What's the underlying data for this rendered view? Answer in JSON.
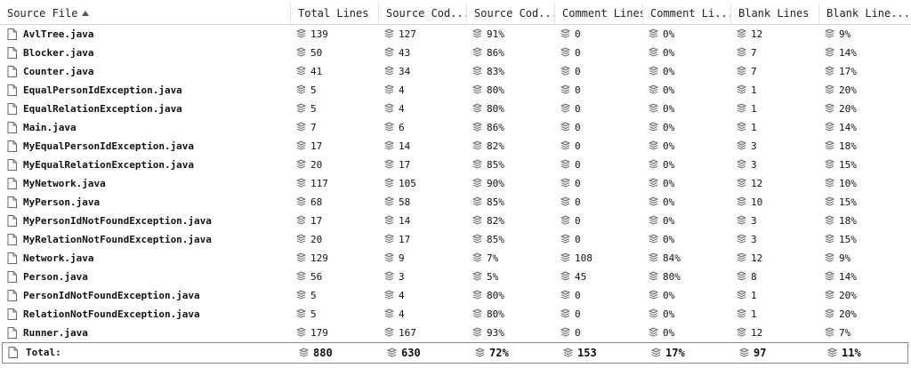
{
  "columns": [
    {
      "label": "Source File",
      "sorted": "ascending"
    },
    {
      "label": "Total Lines"
    },
    {
      "label": "Source Cod..."
    },
    {
      "label": "Source Cod..."
    },
    {
      "label": "Comment Lines"
    },
    {
      "label": "Comment Li..."
    },
    {
      "label": "Blank Lines"
    },
    {
      "label": "Blank Line..."
    }
  ],
  "rows": [
    {
      "file": "AvlTree.java",
      "total": "139",
      "src": "127",
      "src_pct": "91%",
      "cmt": "0",
      "cmt_pct": "0%",
      "blank": "12",
      "blank_pct": "9%"
    },
    {
      "file": "Blocker.java",
      "total": "50",
      "src": "43",
      "src_pct": "86%",
      "cmt": "0",
      "cmt_pct": "0%",
      "blank": "7",
      "blank_pct": "14%"
    },
    {
      "file": "Counter.java",
      "total": "41",
      "src": "34",
      "src_pct": "83%",
      "cmt": "0",
      "cmt_pct": "0%",
      "blank": "7",
      "blank_pct": "17%"
    },
    {
      "file": "EqualPersonIdException.java",
      "total": "5",
      "src": "4",
      "src_pct": "80%",
      "cmt": "0",
      "cmt_pct": "0%",
      "blank": "1",
      "blank_pct": "20%"
    },
    {
      "file": "EqualRelationException.java",
      "total": "5",
      "src": "4",
      "src_pct": "80%",
      "cmt": "0",
      "cmt_pct": "0%",
      "blank": "1",
      "blank_pct": "20%"
    },
    {
      "file": "Main.java",
      "total": "7",
      "src": "6",
      "src_pct": "86%",
      "cmt": "0",
      "cmt_pct": "0%",
      "blank": "1",
      "blank_pct": "14%"
    },
    {
      "file": "MyEqualPersonIdException.java",
      "total": "17",
      "src": "14",
      "src_pct": "82%",
      "cmt": "0",
      "cmt_pct": "0%",
      "blank": "3",
      "blank_pct": "18%"
    },
    {
      "file": "MyEqualRelationException.java",
      "total": "20",
      "src": "17",
      "src_pct": "85%",
      "cmt": "0",
      "cmt_pct": "0%",
      "blank": "3",
      "blank_pct": "15%"
    },
    {
      "file": "MyNetwork.java",
      "total": "117",
      "src": "105",
      "src_pct": "90%",
      "cmt": "0",
      "cmt_pct": "0%",
      "blank": "12",
      "blank_pct": "10%"
    },
    {
      "file": "MyPerson.java",
      "total": "68",
      "src": "58",
      "src_pct": "85%",
      "cmt": "0",
      "cmt_pct": "0%",
      "blank": "10",
      "blank_pct": "15%"
    },
    {
      "file": "MyPersonIdNotFoundException.java",
      "total": "17",
      "src": "14",
      "src_pct": "82%",
      "cmt": "0",
      "cmt_pct": "0%",
      "blank": "3",
      "blank_pct": "18%"
    },
    {
      "file": "MyRelationNotFoundException.java",
      "total": "20",
      "src": "17",
      "src_pct": "85%",
      "cmt": "0",
      "cmt_pct": "0%",
      "blank": "3",
      "blank_pct": "15%"
    },
    {
      "file": "Network.java",
      "total": "129",
      "src": "9",
      "src_pct": "7%",
      "cmt": "108",
      "cmt_pct": "84%",
      "blank": "12",
      "blank_pct": "9%"
    },
    {
      "file": "Person.java",
      "total": "56",
      "src": "3",
      "src_pct": "5%",
      "cmt": "45",
      "cmt_pct": "80%",
      "blank": "8",
      "blank_pct": "14%"
    },
    {
      "file": "PersonIdNotFoundException.java",
      "total": "5",
      "src": "4",
      "src_pct": "80%",
      "cmt": "0",
      "cmt_pct": "0%",
      "blank": "1",
      "blank_pct": "20%"
    },
    {
      "file": "RelationNotFoundException.java",
      "total": "5",
      "src": "4",
      "src_pct": "80%",
      "cmt": "0",
      "cmt_pct": "0%",
      "blank": "1",
      "blank_pct": "20%"
    },
    {
      "file": "Runner.java",
      "total": "179",
      "src": "167",
      "src_pct": "93%",
      "cmt": "0",
      "cmt_pct": "0%",
      "blank": "12",
      "blank_pct": "7%"
    }
  ],
  "total_row": {
    "file": "Total:",
    "total": "880",
    "src": "630",
    "src_pct": "72%",
    "cmt": "153",
    "cmt_pct": "17%",
    "blank": "97",
    "blank_pct": "11%"
  },
  "icons": {
    "file": "file-icon",
    "metric": "stack-icon"
  },
  "colors": {
    "header_border": "#d9d9d9",
    "total_border": "#888888",
    "icon": "#666666"
  }
}
